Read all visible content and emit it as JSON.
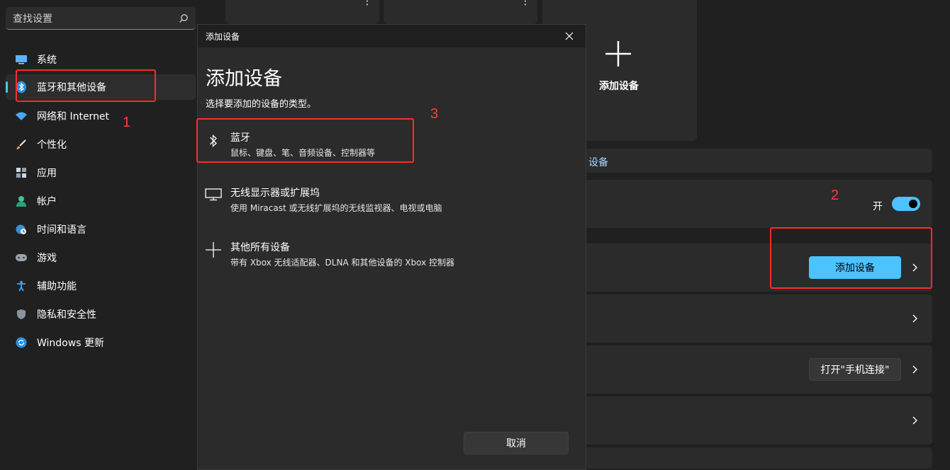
{
  "search": {
    "placeholder": "查找设置"
  },
  "sidebar": {
    "items": [
      {
        "label": "系统",
        "icon": "monitor-icon"
      },
      {
        "label": "蓝牙和其他设备",
        "icon": "bluetooth-icon"
      },
      {
        "label": "网络和 Internet",
        "icon": "wifi-icon"
      },
      {
        "label": "个性化",
        "icon": "brush-icon"
      },
      {
        "label": "应用",
        "icon": "apps-icon"
      },
      {
        "label": "帐户",
        "icon": "person-icon"
      },
      {
        "label": "时间和语言",
        "icon": "globe-clock-icon"
      },
      {
        "label": "游戏",
        "icon": "gamepad-icon"
      },
      {
        "label": "辅助功能",
        "icon": "accessibility-icon"
      },
      {
        "label": "隐私和安全性",
        "icon": "shield-icon"
      },
      {
        "label": "Windows 更新",
        "icon": "update-icon"
      }
    ]
  },
  "main": {
    "add_device_tile_label": "添加设备",
    "partial_section_text": "设备",
    "toggle_label": "开",
    "toggle_on": true,
    "add_device_button": "添加设备",
    "phone_link_button": "打开\"手机连接\""
  },
  "dialog": {
    "window_title": "添加设备",
    "heading": "添加设备",
    "subtitle": "选择要添加的设备的类型。",
    "options": [
      {
        "title": "蓝牙",
        "desc": "鼠标、键盘、笔、音频设备、控制器等",
        "icon": "bluetooth-icon"
      },
      {
        "title": "无线显示器或扩展坞",
        "desc": "使用 Miracast 或无线扩展坞的无线监视器、电视或电脑",
        "icon": "display-icon"
      },
      {
        "title": "其他所有设备",
        "desc": "带有 Xbox 无线适配器、DLNA 和其他设备的 Xbox 控制器",
        "icon": "plus-icon"
      }
    ],
    "cancel": "取消"
  },
  "annotations": {
    "step1": "1",
    "step2": "2",
    "step3": "3",
    "color": "#ff2a2a"
  },
  "colors": {
    "accent": "#4cc2ff",
    "background": "#202020",
    "card": "#2b2b2b"
  }
}
